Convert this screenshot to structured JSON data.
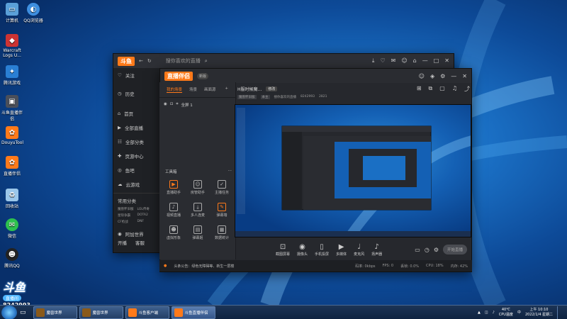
{
  "desktop": {
    "icons": [
      {
        "label": "计算机",
        "name": "computer"
      },
      {
        "label": "QQ浏览器",
        "name": "qq-browser"
      },
      {
        "label": "Warcraft Logs U...",
        "name": "warcraft-logs"
      },
      {
        "label": "腾讯游戏",
        "name": "tencent-games"
      },
      {
        "label": "斗鱼直播伴侣",
        "name": "douyu-studio"
      },
      {
        "label": "DouyuTool",
        "name": "douyu-tool"
      },
      {
        "label": "直播伴侣",
        "name": "live-companion"
      },
      {
        "label": "回收站",
        "name": "recycle-bin"
      },
      {
        "label": "微信",
        "name": "wechat"
      },
      {
        "label": "腾讯QQ",
        "name": "tencent-qq"
      }
    ]
  },
  "back_window": {
    "logo": "斗鱼",
    "search_placeholder": "搜你喜欢的直播",
    "sidebar": [
      {
        "icon": "history-icon",
        "label": "历史"
      },
      {
        "icon": "home-icon",
        "label": "首页"
      },
      {
        "icon": "live-icon",
        "label": "全部直播"
      },
      {
        "icon": "category-icon",
        "label": "全部分类"
      },
      {
        "icon": "gamepad-icon",
        "label": "页游中心"
      },
      {
        "icon": "fishbar-icon",
        "label": "鱼吧"
      },
      {
        "icon": "cloud-icon",
        "label": "云游戏"
      }
    ],
    "follow_label": "关注",
    "common_categories_label": "常用分类",
    "categories": [
      "魔兽怀旧服",
      "LOL传奇",
      "星际争霸",
      "DOTA2",
      "CF枪战",
      "DNF"
    ],
    "browse_label": "阿加世界",
    "bottom": [
      "开播",
      "客服"
    ]
  },
  "front_window": {
    "title_logo": "直播伴侣",
    "version_badge": "新版",
    "tabs": [
      "我的场景",
      "场景",
      "画面源"
    ],
    "scene_label": "全屏 1",
    "stream_title": "H服时候魔...",
    "edit_label": "修改",
    "meta": [
      "魔兽怀旧服",
      "本主",
      "搜你喜欢的直播",
      "8242993",
      "2821"
    ],
    "tools_header": "工具箱",
    "tools": [
      {
        "label": "直播助手",
        "icon": "assistant-icon"
      },
      {
        "label": "房管助手",
        "icon": "admin-icon"
      },
      {
        "label": "主播任务",
        "icon": "task-icon"
      },
      {
        "label": "视频直播",
        "icon": "video-icon"
      },
      {
        "label": "多人连麦",
        "icon": "multi-mic-icon"
      },
      {
        "label": "弹幕墙",
        "icon": "danmu-icon"
      },
      {
        "label": "虚拟形象",
        "icon": "avatar-icon"
      },
      {
        "label": "弹幕姬",
        "icon": "danmu-box-icon"
      },
      {
        "label": "数据统计",
        "icon": "stats-icon"
      }
    ],
    "bottom_tools": [
      {
        "label": "截图屏幕",
        "icon": "screenshot-icon"
      },
      {
        "label": "摄像头",
        "icon": "camera-icon"
      },
      {
        "label": "手机投屏",
        "icon": "phone-icon"
      },
      {
        "label": "多媒体",
        "icon": "media-icon"
      },
      {
        "label": "麦克风",
        "icon": "mic-icon"
      },
      {
        "label": "扬声器",
        "icon": "speaker-icon"
      }
    ],
    "start_button": "开始直播",
    "announcement": "头条公告：绿色无障碍等、新生一层楼",
    "status": [
      "码率: 0kbps",
      "FPS: 0",
      "丢帧: 0.0%",
      "CPU: 18%",
      "内存: 42%"
    ]
  },
  "taskbar": {
    "tasks": [
      {
        "label": "魔兽世界"
      },
      {
        "label": "魔兽世界"
      },
      {
        "label": "斗鱼客户端"
      },
      {
        "label": "斗鱼直播伴侣"
      }
    ],
    "tray": {
      "temp": "40℃",
      "cpu": "CPU温度",
      "time": "上午 10:10",
      "date": "2022/1/4 星期二"
    }
  },
  "watermark": {
    "logo": "斗鱼",
    "badge": "直播间",
    "room_id": "8242993"
  },
  "colors": {
    "accent": "#ff7a1a",
    "window_bg": "#26282d",
    "desktop_blue": "#1a6fc4"
  }
}
